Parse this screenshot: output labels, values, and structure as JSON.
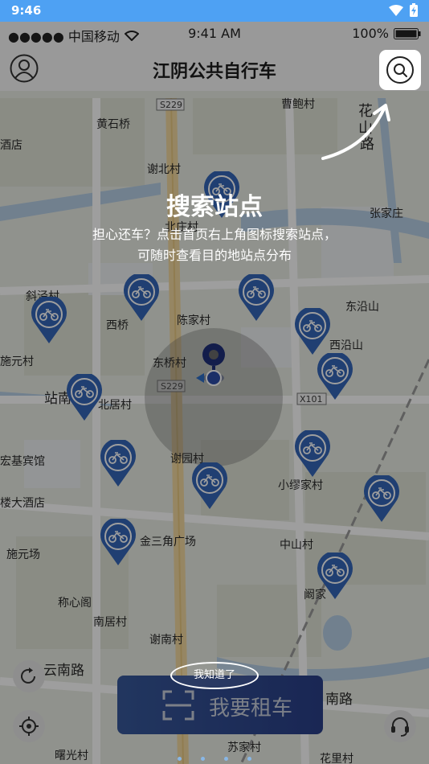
{
  "android_status": {
    "time": "9:46"
  },
  "ios_status": {
    "carrier": "●●●●● 中国移动",
    "time": "9:41 AM",
    "battery": "100%"
  },
  "header": {
    "title": "江阴公共自行车"
  },
  "guide": {
    "title": "搜索站点",
    "line1": "担心还车？点击首页右上角图标搜索站点，",
    "line2": "可随时查看目的地站点分布",
    "got_it": "我知道了"
  },
  "rent": {
    "label": "我要租车"
  },
  "map": {
    "labels": [
      "曹鲍村",
      "花",
      "山",
      "路",
      "黄石桥",
      "酒店",
      "谢北村",
      "北庄村",
      "张家庄",
      "斜泾村",
      "西桥",
      "陈家村",
      "东沿山",
      "西沿山",
      "施元村",
      "东桥村",
      "站南",
      "北居村",
      "宏基宾馆",
      "谢园村",
      "小缪家村",
      "楼大酒店",
      "金三角广场",
      "中山村",
      "施元场",
      "称心阁",
      "阚家",
      "南居村",
      "谢南村",
      "云南路",
      "南路",
      "苏家村",
      "曙光村",
      "花里村"
    ],
    "road_tags": [
      "S229",
      "S229",
      "X101"
    ]
  },
  "colors": {
    "accent": "#4ea1f3",
    "pin": "#3566b8",
    "rent_button": "#2f4a92"
  }
}
